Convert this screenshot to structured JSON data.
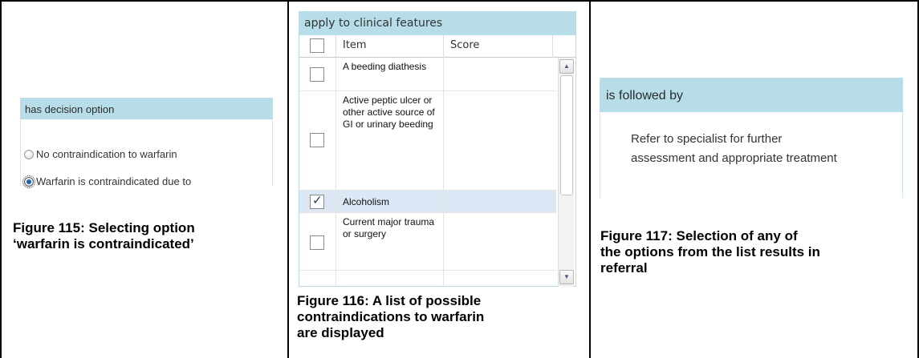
{
  "fig115": {
    "panel_title": "has decision option",
    "options": [
      {
        "label": "No contraindication to warfarin",
        "selected": false
      },
      {
        "label": "Warfarin is contraindicated due to",
        "selected": true
      }
    ],
    "caption_line1": "Figure 115: Selecting option",
    "caption_line2": "‘warfarin is contraindicated’"
  },
  "fig116": {
    "panel_title": "apply to clinical features",
    "columns": {
      "item": "Item",
      "score": "Score"
    },
    "rows": [
      {
        "text": "A beeding diathesis",
        "checked": false
      },
      {
        "text": "Active peptic ulcer or other active source of GI or urinary beeding",
        "checked": false
      },
      {
        "text": "Alcoholism",
        "checked": true
      },
      {
        "text": "Current major trauma or surgery",
        "checked": false
      }
    ],
    "caption_line1": "Figure 116: A list of possible",
    "caption_line2": "contraindications to warfarin",
    "caption_line3": "are displayed"
  },
  "fig117": {
    "panel_title": "is followed by",
    "body_line1": "Refer to specialist for further",
    "body_line2": "assessment and appropriate treatment",
    "caption_line1": "Figure 117: Selection of any of",
    "caption_line2": "the options from the list results in",
    "caption_line3": "referral"
  },
  "icons": {
    "scroll_up": "arrow-up-icon",
    "scroll_down": "arrow-down-icon",
    "checkmark": "check-icon"
  }
}
